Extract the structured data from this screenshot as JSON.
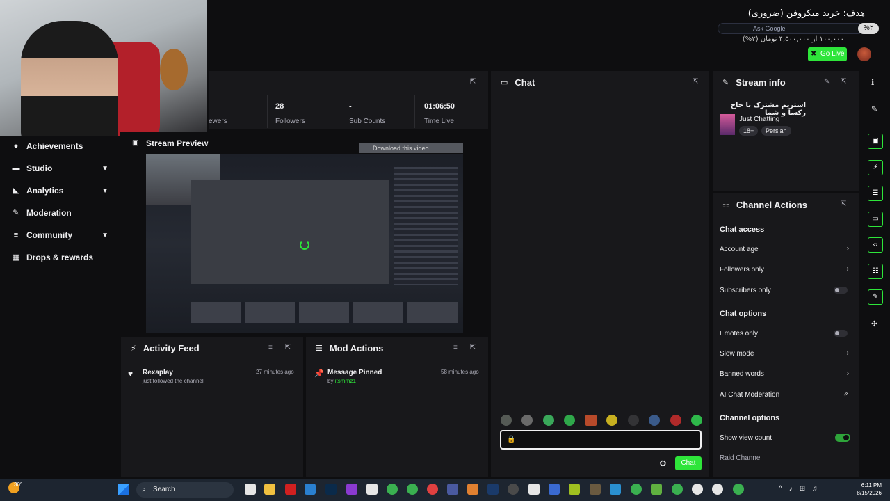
{
  "goal": {
    "title": "هدف: خرید میکروفن (ضروری)",
    "percent": "%۲",
    "progress_text": "۱۰۰,۰۰۰ از ۴,۵۰۰,۰۰۰ تومان (۲%)",
    "progress": 0.02,
    "omnibox_label": "Ask Google"
  },
  "header": {
    "go_live_label": "Go Live"
  },
  "sidebar": {
    "items": [
      {
        "label": "Achievements",
        "icon": "trophy-icon",
        "chevron": false
      },
      {
        "label": "Studio",
        "icon": "studio-icon",
        "chevron": true
      },
      {
        "label": "Analytics",
        "icon": "analytics-icon",
        "chevron": true
      },
      {
        "label": "Moderation",
        "icon": "wrench-icon",
        "chevron": false
      },
      {
        "label": "Community",
        "icon": "community-icon",
        "chevron": true
      },
      {
        "label": "Drops & rewards",
        "icon": "gift-icon",
        "chevron": false
      }
    ]
  },
  "stats": {
    "viewers_label": "ewers",
    "followers_value": "28",
    "followers_label": "Followers",
    "subs_value": "-",
    "subs_label": "Sub Counts",
    "time_value": "01:06:50",
    "time_label": "Time Live"
  },
  "preview": {
    "title": "Stream Preview",
    "download_label": "Download this video"
  },
  "activity": {
    "title": "Activity Feed",
    "items": [
      {
        "user": "Rexaplay",
        "text": "just followed the channel",
        "time": "27 minutes ago"
      }
    ]
  },
  "mod_actions": {
    "title": "Mod Actions",
    "items": [
      {
        "title": "Message Pinned",
        "by_prefix": "by",
        "by_user": "itsmrhz1",
        "time": "58 minutes ago"
      }
    ]
  },
  "chat": {
    "title": "Chat",
    "send_label": "Chat"
  },
  "stream_info": {
    "title": "Stream info",
    "stream_title": "استریم مشترک با حاج رکسا و شما",
    "category": "Just Chatting",
    "tags": [
      "18+",
      "Persian"
    ]
  },
  "channel_actions": {
    "title": "Channel Actions",
    "chat_access": "Chat access",
    "account_age": "Account age",
    "followers_only": "Followers only",
    "subscribers_only": "Subscribers only",
    "chat_options": "Chat options",
    "emotes_only": "Emotes only",
    "slow_mode": "Slow mode",
    "banned_words": "Banned words",
    "ai_chat_moderation": "AI Chat Moderation",
    "channel_options": "Channel options",
    "show_view_count": "Show view count",
    "raid_channel": "Raid Channel"
  },
  "taskbar": {
    "weather": "30°",
    "search_label": "Search",
    "time": "6:11 PM",
    "date": "8/15/2026"
  },
  "colors": {
    "accent": "#2ee53a",
    "panel": "#18181b",
    "background": "#0e0e10"
  }
}
